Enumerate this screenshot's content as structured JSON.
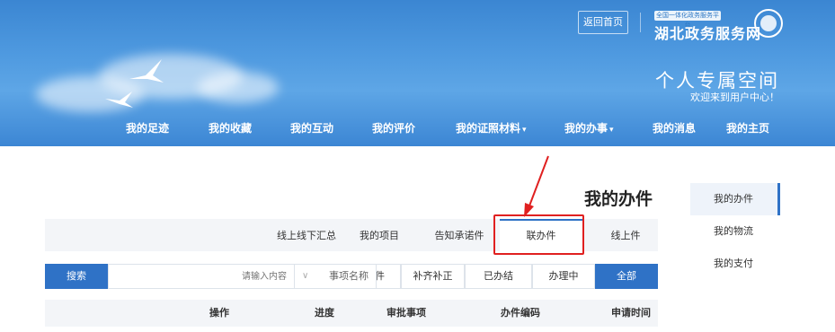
{
  "header": {
    "home_button": "返回首页",
    "logo_small": "全国一体化政务服务平台",
    "logo_big": "湖北政务服务网",
    "title": "个人专属空间",
    "subtitle": "欢迎来到用户中心！"
  },
  "nav": {
    "items": [
      {
        "label": "我的主页"
      },
      {
        "label": "我的消息"
      },
      {
        "label": "我的办事"
      },
      {
        "label": "我的证照材料"
      },
      {
        "label": "我的评价"
      },
      {
        "label": "我的互动"
      },
      {
        "label": "我的收藏"
      },
      {
        "label": "我的足迹"
      }
    ]
  },
  "sidebar": {
    "items": [
      {
        "label": "我的办件"
      },
      {
        "label": "我的物流"
      },
      {
        "label": "我的支付"
      }
    ]
  },
  "main": {
    "title": "我的办件",
    "tabs": [
      {
        "label": "线上件"
      },
      {
        "label": "联办件"
      },
      {
        "label": "告知承诺件"
      },
      {
        "label": "我的项目"
      },
      {
        "label": "线上线下汇总"
      }
    ],
    "filters": [
      {
        "label": "全部"
      },
      {
        "label": "办理中"
      },
      {
        "label": "已办结"
      },
      {
        "label": "补齐补正"
      },
      {
        "label": "草稿件"
      }
    ],
    "select_value": "事项名称",
    "search_placeholder": "请输入内容",
    "search_button": "搜索",
    "columns": [
      {
        "label": "申请时间"
      },
      {
        "label": "办件编码"
      },
      {
        "label": "审批事项"
      },
      {
        "label": "进度"
      },
      {
        "label": "操作"
      }
    ]
  },
  "colors": {
    "accent": "#2f72c6",
    "banner": "#4f9ae0",
    "annotation": "#e02020"
  }
}
